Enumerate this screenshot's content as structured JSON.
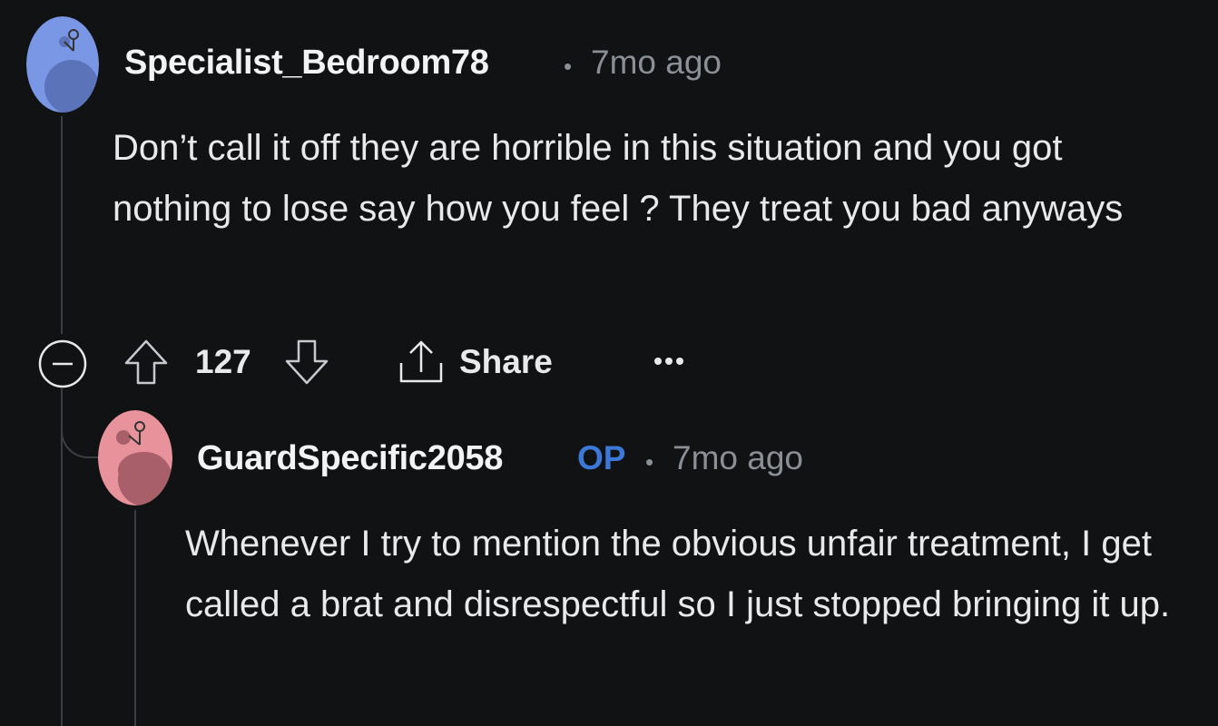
{
  "comments": [
    {
      "username": "Specialist_Bedroom78",
      "separator": "•",
      "time": "7mo ago",
      "body": "Don’t call it off they are horrible in this situation and you got nothing to lose say how you feel ? They treat you bad anyways",
      "avatar_color": "#7a97e6",
      "votes": "127",
      "share_label": "Share",
      "more_label": "···"
    },
    {
      "username": "GuardSpecific2058",
      "op_badge": "OP",
      "separator": "•",
      "time": "7mo ago",
      "body": "Whenever I try to mention the obvious unfair treatment, I get called a brat and disrespectful so I just stopped bringing it up.",
      "avatar_color": "#e8939c"
    }
  ],
  "colors": {
    "background": "#111214",
    "text": "#e8e9ea",
    "muted": "#8a9096",
    "op_accent": "#3c78d8",
    "thread_line": "#3b3f43"
  }
}
